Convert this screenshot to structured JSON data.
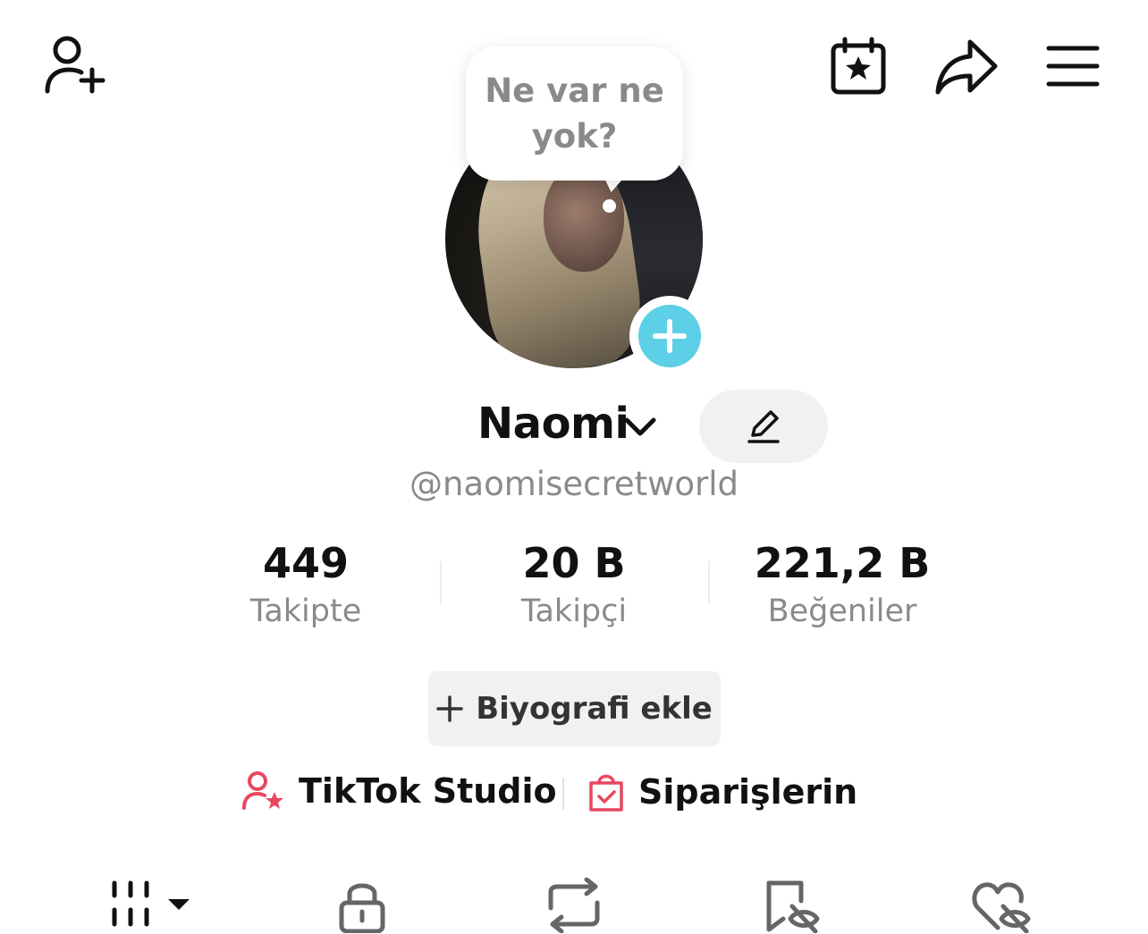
{
  "bubble": {
    "line1": "Ne var ne",
    "line2": "yok?"
  },
  "profile": {
    "name": "Naomi",
    "username": "@naomisecretworld"
  },
  "stats": [
    {
      "value": "449",
      "label": "Takipte"
    },
    {
      "value": "20 B",
      "label": "Takipçi"
    },
    {
      "value": "221,2 B",
      "label": "Beğeniler"
    }
  ],
  "bio": {
    "label": "Biyografi ekle"
  },
  "links": {
    "studio": "TikTok Studio",
    "orders": "Siparişlerin"
  },
  "colors": {
    "accent": "#5dcfe6",
    "red_icon": "#e8475f",
    "muted": "#8a8a8a"
  },
  "icons": [
    "add-user-icon",
    "calendar-star-icon",
    "share-icon",
    "menu-icon",
    "grid-icon",
    "lock-icon",
    "repost-icon",
    "bookmark-eye-icon",
    "heart-eye-icon"
  ]
}
